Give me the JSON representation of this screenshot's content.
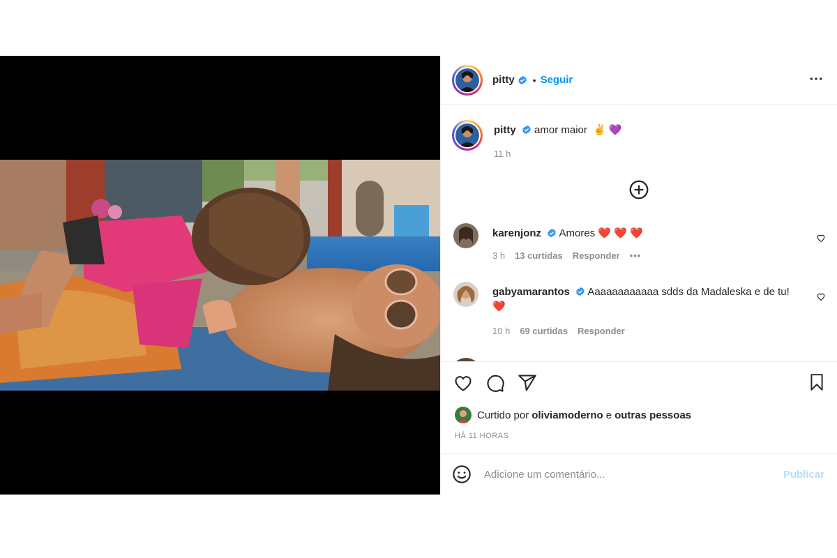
{
  "post": {
    "author": {
      "username": "pitty",
      "follow_label": "Seguir",
      "separator": "•"
    },
    "caption": {
      "username": "pitty",
      "text": "amor maior",
      "emojis": "✌️ 💜",
      "time": "11 h"
    },
    "comments": [
      {
        "username": "karenjonz",
        "text": "Amores",
        "emojis": "❤️ ❤️ ❤️",
        "time": "3 h",
        "likes": "13 curtidas",
        "reply_label": "Responder",
        "more": "•••"
      },
      {
        "username": "gabyamarantos",
        "text": "Aaaaaaaaaaaa sdds da Madaleska e de tu!",
        "emojis": "❤️",
        "time": "10 h",
        "likes": "69 curtidas",
        "reply_label": "Responder"
      }
    ],
    "likes": {
      "prefix": "Curtido por",
      "user": "oliviamoderno",
      "connector": "e",
      "others": "outras pessoas"
    },
    "timestamp": "HÁ 11 HORAS",
    "add_comment": {
      "placeholder": "Adicione um comentário...",
      "publish_label": "Publicar"
    },
    "icons": {
      "header_more": "more-horizontal-icon",
      "load_more": "plus-circle-icon",
      "like": "heart-outline-icon",
      "comment": "comment-bubble-icon",
      "share": "paper-plane-icon",
      "save": "bookmark-icon",
      "emoji": "smiley-icon",
      "verified": "verified-badge-icon"
    },
    "colors": {
      "link_blue": "#0095f6",
      "publish_disabled": "#b2dffc",
      "muted": "#8e8e8e",
      "verified": "#3897f0",
      "heart_red": "#ed4956"
    }
  }
}
